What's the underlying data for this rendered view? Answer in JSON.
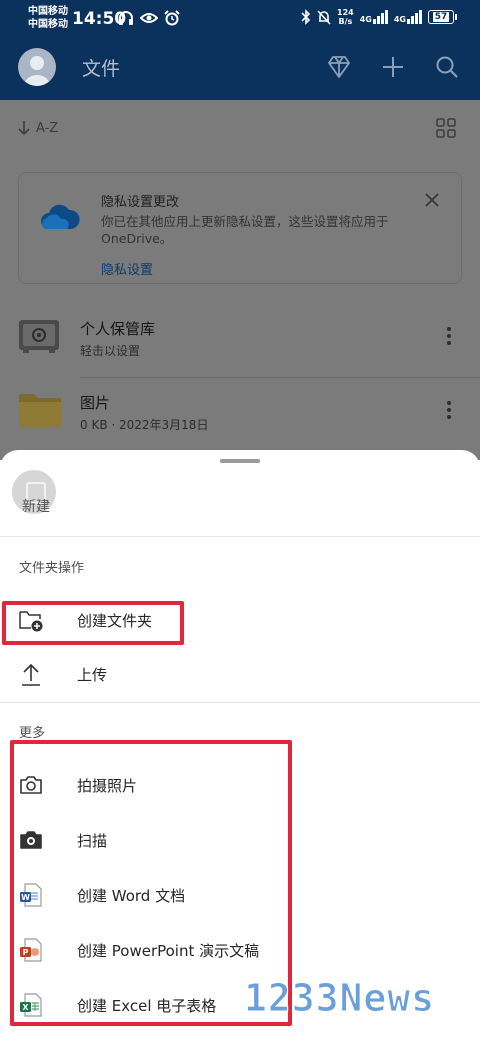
{
  "status_bar": {
    "carrier1": "中国移动",
    "carrier2": "中国移动",
    "time": "14:50",
    "net_speed_value": "124",
    "net_speed_unit": "B/s",
    "sig1": "4G",
    "sig2": "4G",
    "battery": "57",
    "icons_left": [
      "headphones-icon",
      "eye-icon",
      "alarm-icon"
    ],
    "icons_right": [
      "bluetooth-icon",
      "mute-bell-icon"
    ]
  },
  "app_bar": {
    "title": "文件",
    "actions": [
      "diamond-icon",
      "plus-icon",
      "search-icon"
    ]
  },
  "toolbar": {
    "sort_label": "A-Z"
  },
  "privacy_card": {
    "title": "隐私设置更改",
    "text": "你已在其他应用上更新隐私设置，这些设置将应用于 OneDrive。",
    "link": "隐私设置"
  },
  "files": [
    {
      "name": "个人保管库",
      "meta": "轻击以设置",
      "icon": "vault-icon"
    },
    {
      "name": "图片",
      "meta": "0 KB · 2022年3月18日",
      "icon": "folder-icon"
    }
  ],
  "sheet": {
    "new_label": "新建",
    "section_folder": "文件夹操作",
    "folder_actions": [
      {
        "label": "创建文件夹",
        "icon": "new-folder-icon"
      },
      {
        "label": "上传",
        "icon": "upload-icon"
      }
    ],
    "section_more": "更多",
    "more_actions": [
      {
        "label": "拍摄照片",
        "icon": "camera-icon"
      },
      {
        "label": "扫描",
        "icon": "scan-camera-icon"
      },
      {
        "label": "创建 Word 文档",
        "icon": "word-icon"
      },
      {
        "label": "创建 PowerPoint 演示文稿",
        "icon": "powerpoint-icon"
      },
      {
        "label": "创建 Excel 电子表格",
        "icon": "excel-icon"
      }
    ]
  },
  "colors": {
    "app_bar": "#0b315d",
    "highlight": "#e0283a",
    "word": "#2b579a",
    "powerpoint": "#c43e1c",
    "excel": "#217346"
  },
  "watermark": "1233News"
}
